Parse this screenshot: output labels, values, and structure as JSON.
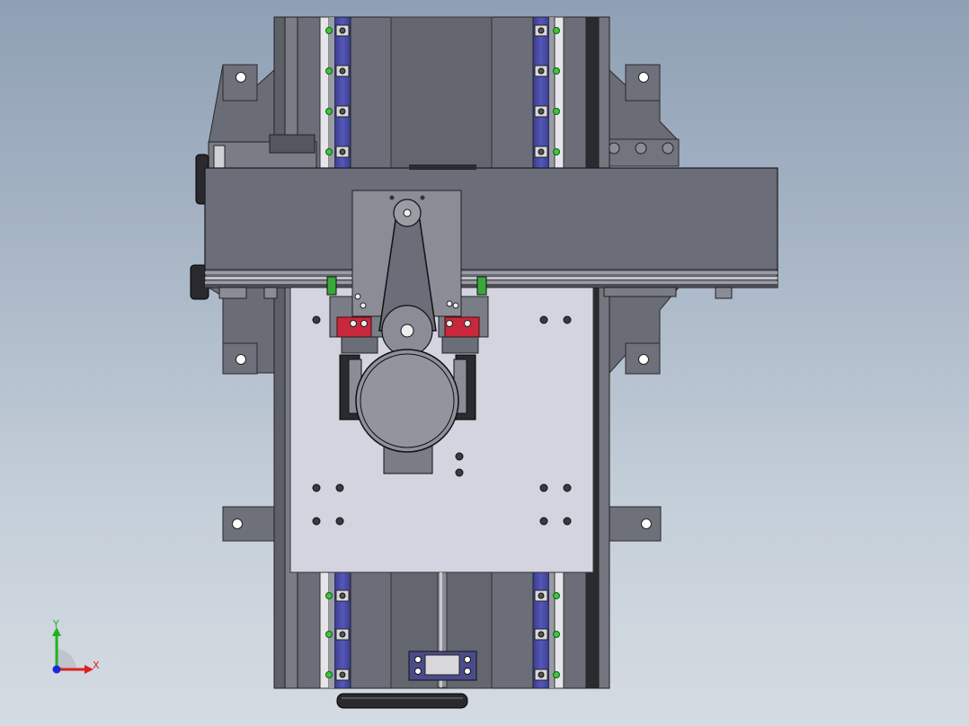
{
  "viewport": {
    "background_top": "#8fa0b4",
    "background_bottom": "#d5dbe2"
  },
  "triad": {
    "x_label": "X",
    "y_label": "Y",
    "x_color": "#e0201c",
    "y_color": "#1fb21f",
    "z_color": "#1a28d8"
  },
  "model": {
    "body_color": "#6b6d78",
    "plate_color": "#d4d4e0",
    "rail_color": "#4a4ca8",
    "block_color": "#c8283c",
    "bolt_highlight": "#39c83a"
  }
}
